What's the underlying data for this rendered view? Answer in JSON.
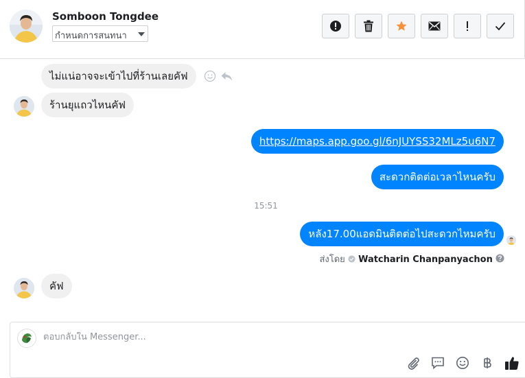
{
  "header": {
    "contact_name": "Somboon Tongdee",
    "assign_label": "กำหนดการสนทนา",
    "toolbar": [
      {
        "icon": "alert-circle-icon",
        "name": "mark-spam-button"
      },
      {
        "icon": "trash-icon",
        "name": "delete-button"
      },
      {
        "icon": "star-icon",
        "name": "star-button"
      },
      {
        "icon": "envelope-icon",
        "name": "mark-unread-button"
      },
      {
        "icon": "exclamation-icon",
        "name": "follow-up-button"
      },
      {
        "icon": "check-icon",
        "name": "mark-done-button"
      }
    ]
  },
  "messages": {
    "m1": "ไม่แน่อาจจะเข้าไปที่ร้านเลยคัฟ",
    "m2": "ร้านยุแถวไหนคัฟ",
    "m3": "https://maps.app.goo.gl/6nJUYSS32MLz5u6N7",
    "m4": "สะดวกติดต่อเวลาไหนครับ",
    "timestamp": "15:51",
    "m5": "หลัง17.00แอดมินติดต่อไปสะดวกไหมครับ",
    "sent_by_prefix": "ส่งโดย",
    "sent_by_name": "Watcharin Chanpanyachon",
    "m6": "คัฟ"
  },
  "composer": {
    "placeholder": "ตอบกลับใน Messenger..."
  },
  "colors": {
    "accent": "#0084ff",
    "star": "#f7923a",
    "incoming_bubble": "#f1f0f0"
  }
}
